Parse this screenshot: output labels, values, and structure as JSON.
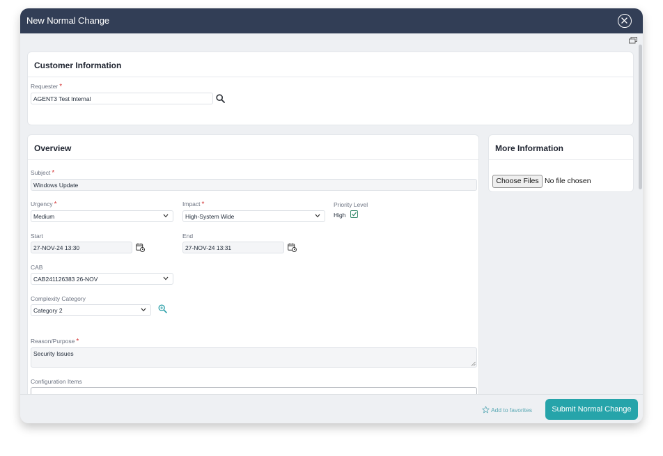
{
  "window": {
    "title": "New Normal Change"
  },
  "customer": {
    "section_title": "Customer Information",
    "requester_label": "Requester",
    "required_mark": "*",
    "requester_value": "AGENT3 Test   Internal"
  },
  "overview": {
    "section_title": "Overview",
    "subject_label": "Subject",
    "subject_value": "Windows Update",
    "urgency_label": "Urgency",
    "urgency_value": "Medium",
    "impact_label": "Impact",
    "impact_value": "High-System Wide",
    "priority_label": "Priority Level",
    "priority_value": "High",
    "start_label": "Start",
    "start_value": "27-NOV-24 13:30",
    "end_label": "End",
    "end_value": "27-NOV-24 13:31",
    "cab_label": "CAB",
    "cab_value": "CAB241126383 26-NOV",
    "complexity_label": "Complexity Category",
    "complexity_value": "Category 2",
    "reason_label": "Reason/Purpose",
    "reason_value": "Security Issues",
    "config_label": "Configuration Items"
  },
  "more_info": {
    "section_title": "More Information",
    "choose_files_label": "Choose Files",
    "no_file_text": "No file chosen"
  },
  "footer": {
    "favorites_label": "Add to favorites",
    "submit_label": "Submit Normal Change"
  },
  "colors": {
    "header": "#323e56",
    "accent": "#26a4aa",
    "required": "#d32f2f"
  },
  "icons": [
    "close-circle-icon",
    "restore-window-icon",
    "search-icon",
    "calendar-clock-icon",
    "zoom-in-icon",
    "star-outline-icon",
    "chevron-down-icon",
    "checkbox-checked-icon"
  ]
}
